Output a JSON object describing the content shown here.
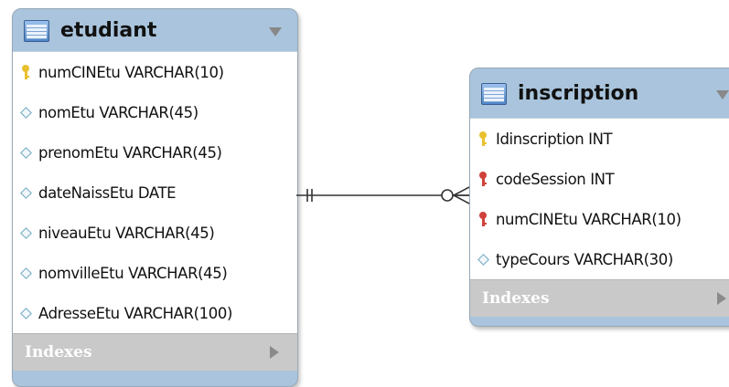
{
  "tables": {
    "etudiant": {
      "name": "etudiant",
      "columns": [
        {
          "key": "pk",
          "text": "numCINEtu VARCHAR(10)"
        },
        {
          "key": "none",
          "text": "nomEtu VARCHAR(45)"
        },
        {
          "key": "none",
          "text": "prenomEtu VARCHAR(45)"
        },
        {
          "key": "none",
          "text": "dateNaissEtu DATE"
        },
        {
          "key": "none",
          "text": "niveauEtu VARCHAR(45)"
        },
        {
          "key": "none",
          "text": "nomvilleEtu VARCHAR(45)"
        },
        {
          "key": "none",
          "text": "AdresseEtu VARCHAR(100)"
        }
      ],
      "indexes_label": "Indexes"
    },
    "inscription": {
      "name": "inscription",
      "columns": [
        {
          "key": "pk",
          "text": "Idinscription INT"
        },
        {
          "key": "fk",
          "text": "codeSession INT"
        },
        {
          "key": "fk",
          "text": "numCINEtu VARCHAR(10)"
        },
        {
          "key": "none",
          "text": "typeCours VARCHAR(30)"
        }
      ],
      "indexes_label": "Indexes"
    }
  },
  "relationship": {
    "from": "etudiant",
    "to": "inscription",
    "from_cardinality": "one-and-only-one",
    "to_cardinality": "zero-or-many"
  },
  "colors": {
    "header": "#a9c4dc",
    "indexes_bar": "#c9c9c9",
    "primary_key": "#e8c130",
    "foreign_key": "#d0413c",
    "line": "#333333"
  }
}
